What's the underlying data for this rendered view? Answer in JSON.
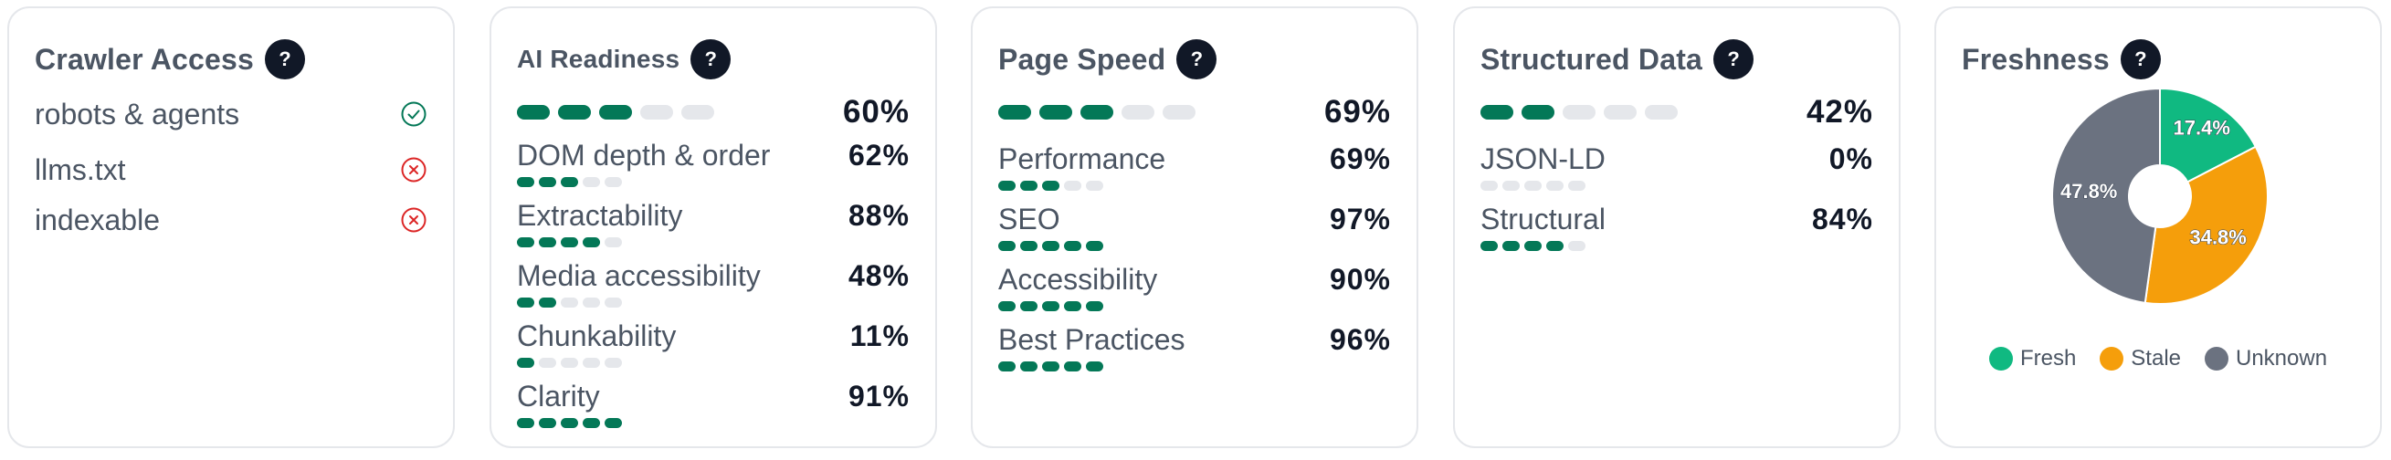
{
  "crawler": {
    "title": "Crawler Access",
    "help": "?",
    "items": [
      {
        "label": "robots & agents",
        "status": "ok"
      },
      {
        "label": "llms.txt",
        "status": "fail"
      },
      {
        "label": "indexable",
        "status": "fail"
      }
    ]
  },
  "ai": {
    "title": "AI Readiness",
    "help": "?",
    "overall": {
      "pct": "60%",
      "value": 60
    },
    "metrics": [
      {
        "label": "DOM depth & order",
        "pct": "62%",
        "value": 62
      },
      {
        "label": "Extractability",
        "pct": "88%",
        "value": 88
      },
      {
        "label": "Media accessibility",
        "pct": "48%",
        "value": 48
      },
      {
        "label": "Chunkability",
        "pct": "11%",
        "value": 11
      },
      {
        "label": "Clarity",
        "pct": "91%",
        "value": 91
      }
    ]
  },
  "speed": {
    "title": "Page Speed",
    "help": "?",
    "overall": {
      "pct": "69%",
      "value": 69
    },
    "metrics": [
      {
        "label": "Performance",
        "pct": "69%",
        "value": 69
      },
      {
        "label": "SEO",
        "pct": "97%",
        "value": 97
      },
      {
        "label": "Accessibility",
        "pct": "90%",
        "value": 90
      },
      {
        "label": "Best Practices",
        "pct": "96%",
        "value": 96
      }
    ]
  },
  "structured": {
    "title": "Structured Data",
    "help": "?",
    "overall": {
      "pct": "42%",
      "value": 42
    },
    "metrics": [
      {
        "label": "JSON-LD",
        "pct": "0%",
        "value": 0
      },
      {
        "label": "Structural",
        "pct": "84%",
        "value": 84
      }
    ]
  },
  "freshness": {
    "title": "Freshness",
    "help": "?",
    "legend": [
      {
        "label": "Fresh",
        "color": "#10b981"
      },
      {
        "label": "Stale",
        "color": "#f59e0b"
      },
      {
        "label": "Unknown",
        "color": "#6b7280"
      }
    ]
  },
  "chart_data": {
    "type": "pie",
    "categories": [
      "Fresh",
      "Stale",
      "Unknown"
    ],
    "values": [
      17.4,
      34.8,
      47.8
    ],
    "labels": [
      "17.4%",
      "34.8%",
      "47.8%"
    ],
    "colors": [
      "#10b981",
      "#f59e0b",
      "#6b7280"
    ],
    "legend": "bottom"
  },
  "colors": {
    "bar_on": "#047857",
    "bar_off": "#e5e7eb",
    "ok": "#047857",
    "fail": "#dc2626"
  }
}
